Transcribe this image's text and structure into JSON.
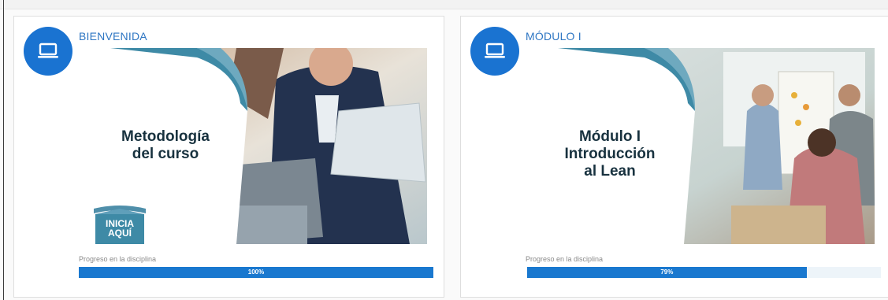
{
  "colors": {
    "accent": "#1a73d1",
    "progress": "#1978cf",
    "title": "#2e76c3",
    "teal": "#3e8aa6"
  },
  "cards": [
    {
      "icon": "laptop-icon",
      "title": "BIENVENIDA",
      "banner": {
        "line1": "Metodología",
        "line2": "del curso",
        "line3": "",
        "cta_line1": "INICIA",
        "cta_line2": "AQUÍ"
      },
      "progress_label": "Progreso en la disciplina",
      "progress_text": "100%",
      "progress_fraction": 1.0
    },
    {
      "icon": "laptop-icon",
      "title": "MÓDULO I",
      "banner": {
        "line1": "Módulo I",
        "line2": "Introducción",
        "line3": "al Lean"
      },
      "progress_label": "Progreso en la disciplina",
      "progress_text": "79%",
      "progress_fraction": 0.79
    }
  ]
}
